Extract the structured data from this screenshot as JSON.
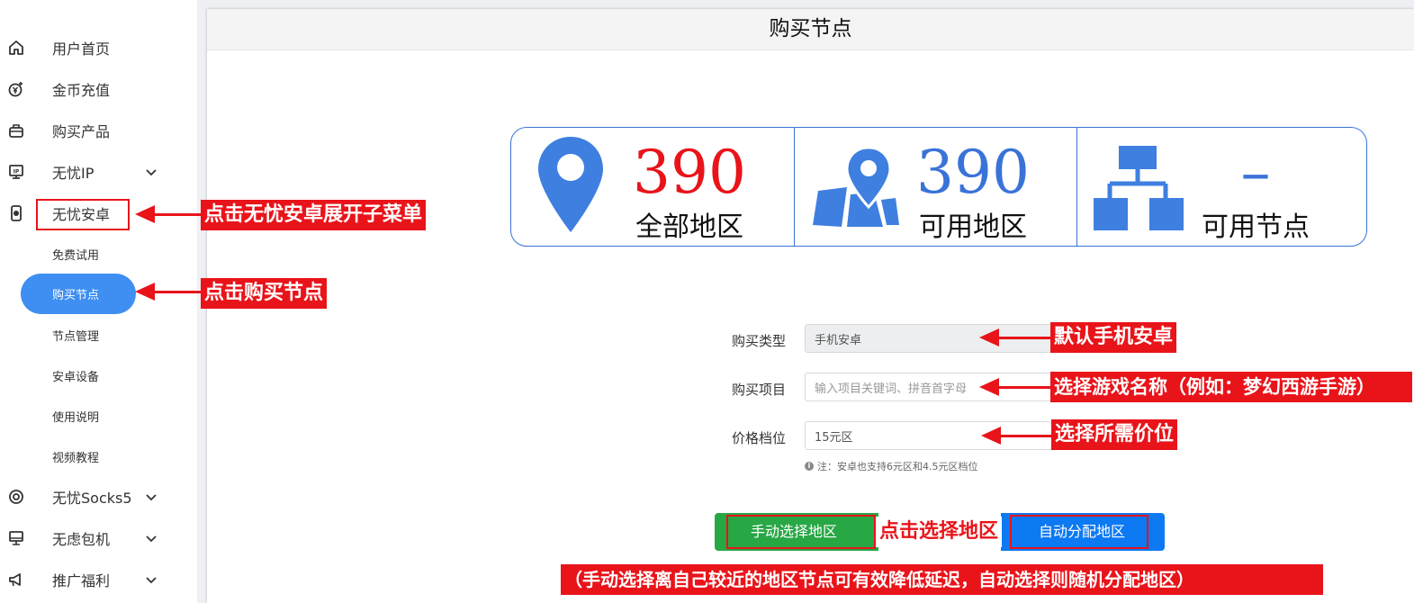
{
  "sidebar": {
    "items": [
      {
        "label": "用户首页",
        "icon": "home-icon"
      },
      {
        "label": "金币充值",
        "icon": "coin-recharge-icon"
      },
      {
        "label": "购买产品",
        "icon": "shopping-bag-icon"
      },
      {
        "label": "无忧IP",
        "icon": "ip-monitor-icon"
      },
      {
        "label": "无忧安卓",
        "icon": "android-phone-icon"
      },
      {
        "label": "无忧Socks5",
        "icon": "socks-target-icon"
      },
      {
        "label": "无虑包机",
        "icon": "desktop-icon"
      },
      {
        "label": "推广福利",
        "icon": "megaphone-icon"
      }
    ],
    "sub_items": [
      "免费试用",
      "购买节点",
      "节点管理",
      "安卓设备",
      "使用说明",
      "视频教程"
    ]
  },
  "page": {
    "title": "购买节点"
  },
  "stats": [
    {
      "value": "390",
      "label": "全部地区",
      "value_color": "#e8141a",
      "icon": "location-pin-icon"
    },
    {
      "value": "390",
      "label": "可用地区",
      "value_color": "#3a73d8",
      "icon": "map-pin-icon"
    },
    {
      "value": "–",
      "label": "可用节点",
      "value_color": "#3a73d8",
      "icon": "network-tree-icon"
    }
  ],
  "form": {
    "type_label": "购买类型",
    "type_value": "手机安卓",
    "project_label": "购买项目",
    "project_placeholder": "输入项目关键词、拼音首字母",
    "price_label": "价格档位",
    "price_value": "15元区",
    "note": "注：安卓也支持6元区和4.5元区档位"
  },
  "buttons": {
    "manual": "手动选择地区",
    "auto": "自动分配地区"
  },
  "annotations": {
    "expand_menu": "点击无忧安卓展开子菜单",
    "click_buy": "点击购买节点",
    "default_android": "默认手机安卓",
    "choose_game": "选择游戏名称（例如：梦幻西游手游）",
    "choose_price": "选择所需价位",
    "click_region": "点击选择地区",
    "bottom_tip": "（手动选择离自己较近的地区节点可有效降低延迟，自动选择则随机分配地区）"
  },
  "colors": {
    "accent": "#3e8ff1",
    "annotation_red": "#e8141a",
    "green_button": "#28a745",
    "blue_button": "#0d79f2"
  }
}
